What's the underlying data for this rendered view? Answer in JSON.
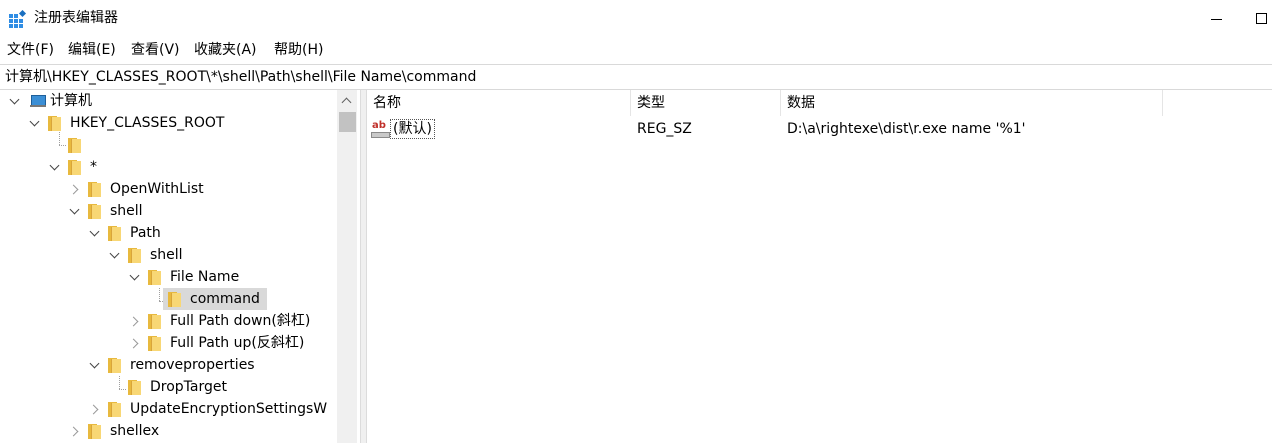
{
  "window": {
    "title": "注册表编辑器"
  },
  "menu": [
    "文件(F)",
    "编辑(E)",
    "查看(V)",
    "收藏夹(A)",
    "帮助(H)"
  ],
  "address": "计算机\\HKEY_CLASSES_ROOT\\*\\shell\\Path\\shell\\File Name\\command",
  "tree": {
    "computer": "计算机",
    "hkcr": "HKEY_CLASSES_ROOT",
    "star": "*",
    "openwithlist": "OpenWithList",
    "shell": "shell",
    "path": "Path",
    "path_shell": "shell",
    "file_name": "File Name",
    "command": "command",
    "full_path_down": "Full Path down(斜杠)",
    "full_path_up": "Full Path up(反斜杠)",
    "removeproperties": "removeproperties",
    "droptarget": "DropTarget",
    "updateencryption": "UpdateEncryptionSettingsW",
    "shellex": "shellex"
  },
  "list": {
    "columns": {
      "name": "名称",
      "type": "类型",
      "data": "数据"
    },
    "rows": [
      {
        "name": "(默认)",
        "type": "REG_SZ",
        "data": "D:\\a\\rightexe\\dist\\r.exe name '%1'",
        "icon": "string-value-icon"
      }
    ]
  },
  "icons": {
    "app": "registry-editor-icon",
    "value": "ab-string-icon"
  },
  "colors": {
    "selected_bg": "#d9d9d9",
    "folder": "#f8d775",
    "ab_red": "#c0302a"
  }
}
